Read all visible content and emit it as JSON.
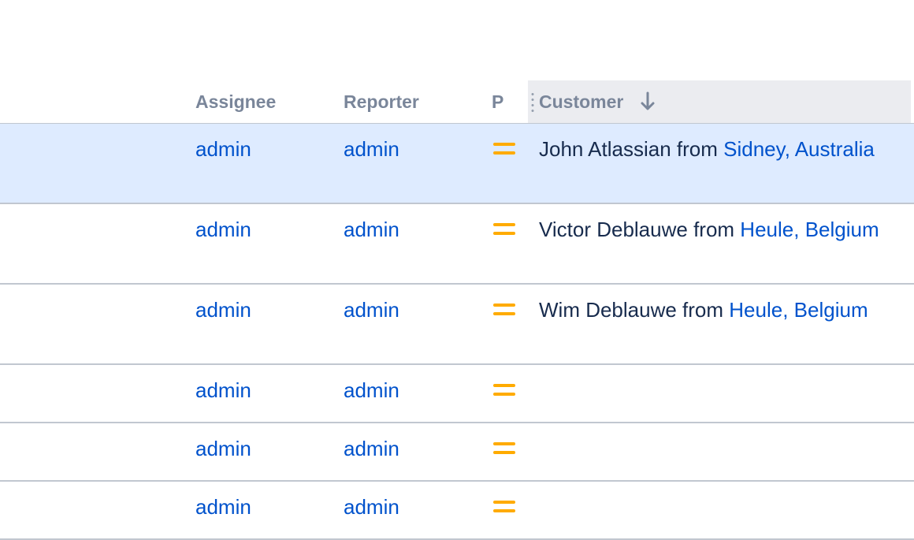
{
  "headers": {
    "assignee": "Assignee",
    "reporter": "Reporter",
    "priority": "P",
    "customer": "Customer"
  },
  "sort": {
    "column": "Customer",
    "direction": "descending",
    "icon": "arrow-down-icon"
  },
  "priority_icon": "medium-priority-icon",
  "colors": {
    "link": "#0052cc",
    "selected_row": "#deebff",
    "priority_medium": "#ffab00",
    "header_text": "#7a869a"
  },
  "rows": [
    {
      "assignee": "admin",
      "reporter": "admin",
      "priority": "Medium",
      "customer_name": "John Atlassian",
      "customer_from": " from ",
      "customer_city": "Sidney,",
      "customer_country": "Australia",
      "selected": true
    },
    {
      "assignee": "admin",
      "reporter": "admin",
      "priority": "Medium",
      "customer_name": "Victor Deblauwe",
      "customer_from": " from ",
      "customer_city": "Heule,",
      "customer_country": "Belgium",
      "selected": false
    },
    {
      "assignee": "admin",
      "reporter": "admin",
      "priority": "Medium",
      "customer_name": "Wim Deblauwe",
      "customer_from": " from ",
      "customer_city": "Heule,",
      "customer_country": "Belgium",
      "selected": false
    },
    {
      "assignee": "admin",
      "reporter": "admin",
      "priority": "Medium",
      "customer_name": "",
      "customer_from": "",
      "customer_city": "",
      "customer_country": "",
      "selected": false
    },
    {
      "assignee": "admin",
      "reporter": "admin",
      "priority": "Medium",
      "customer_name": "",
      "customer_from": "",
      "customer_city": "",
      "customer_country": "",
      "selected": false
    },
    {
      "assignee": "admin",
      "reporter": "admin",
      "priority": "Medium",
      "customer_name": "",
      "customer_from": "",
      "customer_city": "",
      "customer_country": "",
      "selected": false
    }
  ]
}
